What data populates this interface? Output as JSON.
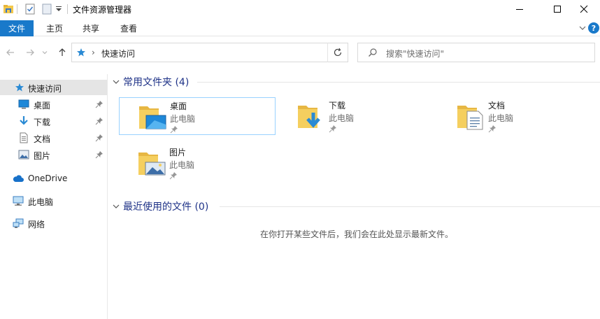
{
  "window": {
    "title": "文件资源管理器",
    "minimize_icon": "minimize-icon",
    "maximize_icon": "maximize-icon",
    "close_icon": "close-icon"
  },
  "ribbon": {
    "tabs": [
      "文件",
      "主页",
      "共享",
      "查看"
    ],
    "accent": "#1979ca",
    "help_label": "?"
  },
  "address": {
    "crumb": "快速访问",
    "separator": "›"
  },
  "search": {
    "placeholder": "搜索\"快速访问\""
  },
  "nav": {
    "items": [
      {
        "label": "快速访问",
        "icon": "star-icon"
      },
      {
        "label": "桌面",
        "icon": "desktop-icon",
        "pinned": true
      },
      {
        "label": "下载",
        "icon": "download-icon",
        "pinned": true
      },
      {
        "label": "文档",
        "icon": "document-icon",
        "pinned": true
      },
      {
        "label": "图片",
        "icon": "picture-icon",
        "pinned": true
      },
      {
        "label": "OneDrive",
        "icon": "cloud-icon"
      },
      {
        "label": "此电脑",
        "icon": "computer-icon"
      },
      {
        "label": "网络",
        "icon": "network-icon"
      }
    ]
  },
  "content": {
    "frequent_header": "常用文件夹 (4)",
    "recent_header": "最近使用的文件 (0)",
    "empty_message": "在你打开某些文件后，我们会在此处显示最新文件。",
    "folders": [
      {
        "name": "桌面",
        "location": "此电脑"
      },
      {
        "name": "下载",
        "location": "此电脑"
      },
      {
        "name": "文档",
        "location": "此电脑"
      },
      {
        "name": "图片",
        "location": "此电脑"
      }
    ]
  }
}
